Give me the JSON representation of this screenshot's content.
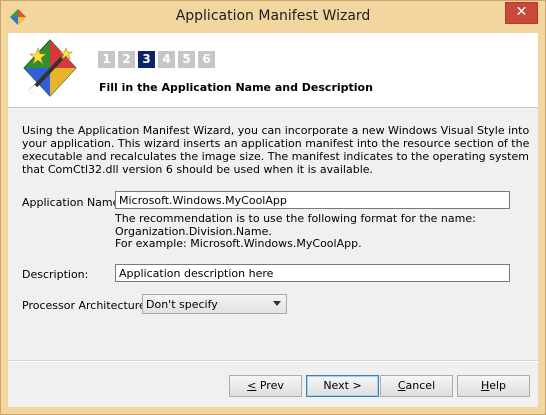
{
  "window": {
    "title": "Application Manifest Wizard",
    "close_glyph": "✕"
  },
  "steps": [
    "1",
    "2",
    "3",
    "4",
    "5",
    "6"
  ],
  "active_step": 3,
  "header": {
    "text": "Fill in the Application Name and Description"
  },
  "intro": "Using the Application Manifest Wizard, you can incorporate a new Windows Visual Style into your application. This wizard inserts an application manifest into the resource section of the executable and recalculates the image size. The manifest indicates to the operating system that ComCtl32.dll version 6 should be used when it is available.",
  "form": {
    "app_name_label": "Application Name:",
    "app_name_value": "Microsoft.Windows.MyCoolApp",
    "hint_line1": "The recommendation is to use the following format for the name:",
    "hint_line2": "Organization.Division.Name.",
    "hint_line3": "For example: Microsoft.Windows.MyCoolApp.",
    "description_label": "Description:",
    "description_value": "Application description here",
    "processor_label": "Processor Architecture:",
    "processor_value": "Don't specify"
  },
  "buttons": {
    "prev_mnemonic": "<",
    "prev_rest": " Prev",
    "next_label": "Next >",
    "cancel_mnemonic": "C",
    "cancel_rest": "ancel",
    "help_mnemonic": "H",
    "help_rest": "elp"
  },
  "colors": {
    "frame": "#f3d59f",
    "active_step": "#0a246a",
    "inactive_step": "#c6c6c6",
    "close": "#c9483c"
  }
}
